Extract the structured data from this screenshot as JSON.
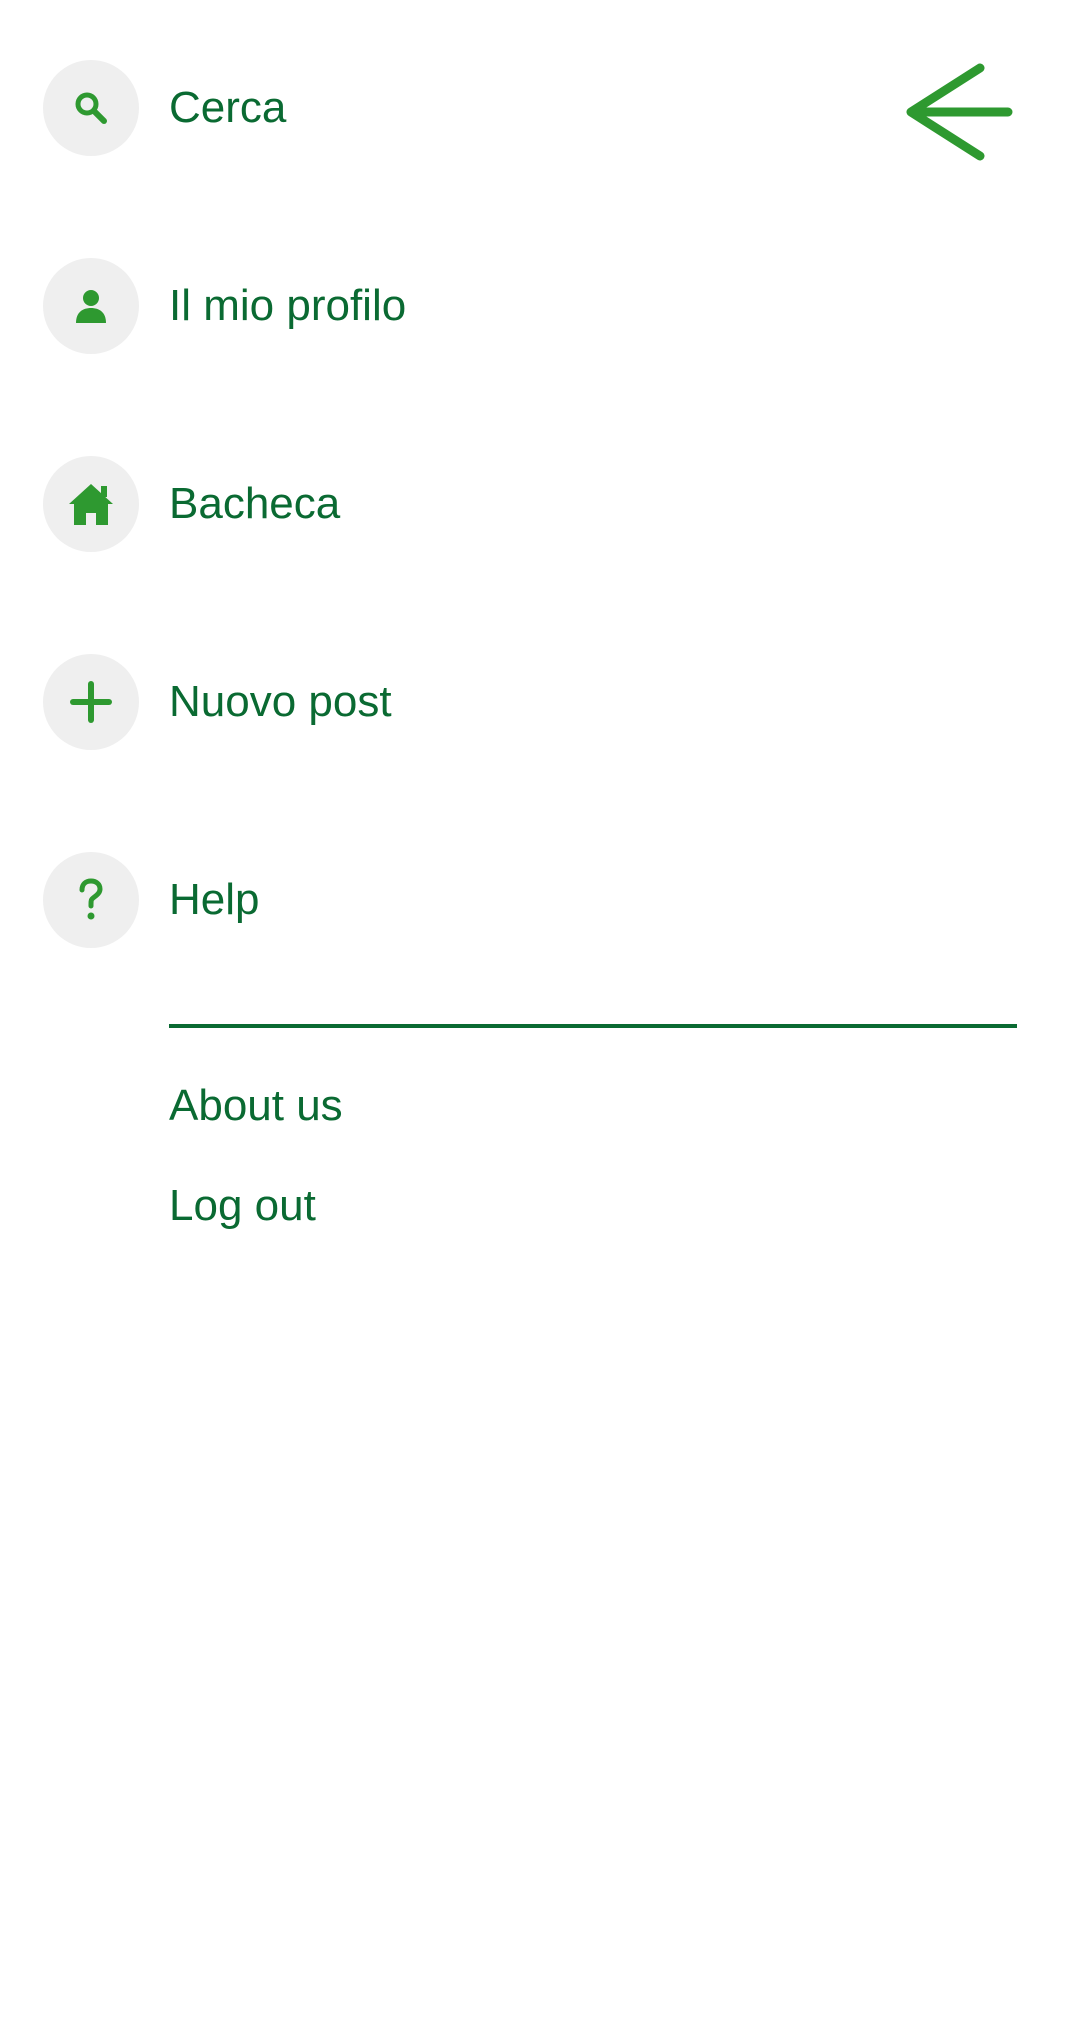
{
  "menu": {
    "items": [
      {
        "label": "Cerca",
        "icon": "search-icon"
      },
      {
        "label": "Il mio profilo",
        "icon": "person-icon"
      },
      {
        "label": "Bacheca",
        "icon": "home-icon"
      },
      {
        "label": "Nuovo post",
        "icon": "plus-icon"
      },
      {
        "label": "Help",
        "icon": "question-icon"
      }
    ]
  },
  "footer_links": {
    "about": "About us",
    "logout": "Log out"
  },
  "header": {
    "back_icon": "arrow-left-icon"
  },
  "colors": {
    "icon_green": "#2e9930",
    "text_green": "#0a6a32",
    "icon_background": "#efefef",
    "background": "#ffffff"
  }
}
